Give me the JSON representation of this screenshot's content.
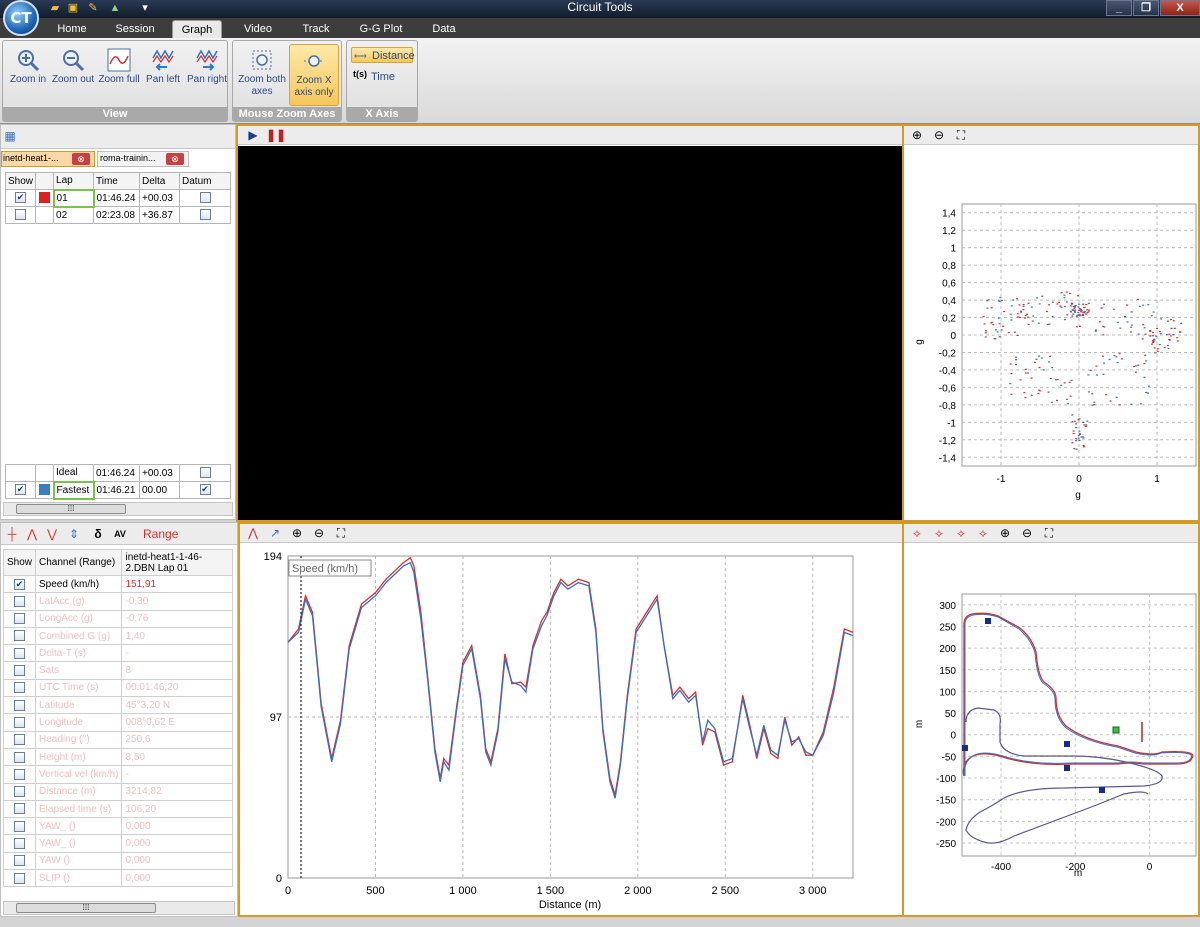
{
  "window": {
    "title": "Circuit Tools",
    "logo": "CT",
    "minimize": "_",
    "restore": "❐",
    "close": "X"
  },
  "menu": [
    "Home",
    "Session",
    "Graph",
    "Video",
    "Track",
    "G-G Plot",
    "Data"
  ],
  "ribbon": {
    "view_group": "View",
    "zoom_in": "Zoom in",
    "zoom_out": "Zoom out",
    "zoom_full": "Zoom full",
    "pan_left": "Pan left",
    "pan_right": "Pan right",
    "mouse_group": "Mouse Zoom Axes",
    "zoom_both": "Zoom both axes",
    "zoom_x": "Zoom X axis only",
    "xaxis_group": "X Axis",
    "distance": "Distance",
    "time_icon": "t(s)",
    "time": "Time"
  },
  "laps": {
    "session_tabs": [
      "inetd-heat1-...",
      "roma-trainin..."
    ],
    "headers": {
      "show": "Show",
      "lap": "Lap",
      "time": "Time",
      "delta": "Delta",
      "datum": "Datum"
    },
    "rows": [
      {
        "lap": "01",
        "time": "01:46.24",
        "delta": "+00.03",
        "checked": true,
        "color": "#e02020"
      },
      {
        "lap": "02",
        "time": "02:23.08",
        "delta": "+36.87",
        "checked": false,
        "color": ""
      }
    ],
    "ideal": {
      "lap": "Ideal",
      "time": "01:46.24",
      "delta": "+00.03"
    },
    "fastest": {
      "lap": "Fastest",
      "time": "01:46.21",
      "delta": "00.00",
      "color": "#3a7fc2"
    }
  },
  "channels": {
    "range_label": "Range",
    "headers": {
      "show": "Show",
      "channel": "Channel (Range)",
      "session": "inetd-heat1-1-46-2.DBN Lap 01"
    },
    "rows": [
      {
        "name": "Speed (km/h)",
        "value": "151,91",
        "checked": true
      },
      {
        "name": "LatAcc (g)",
        "value": "-0,30",
        "checked": false
      },
      {
        "name": "LongAcc (g)",
        "value": "-0,76",
        "checked": false
      },
      {
        "name": "Combined G (g)",
        "value": "1,40",
        "checked": false
      },
      {
        "name": "Delta-T (s)",
        "value": "-",
        "checked": false
      },
      {
        "name": "Sats",
        "value": "8",
        "checked": false
      },
      {
        "name": "UTC Time (s)",
        "value": "00:01:46,20",
        "checked": false
      },
      {
        "name": "Latitude",
        "value": "45°3,20 N",
        "checked": false
      },
      {
        "name": "Longitude",
        "value": "008°0,62 E",
        "checked": false
      },
      {
        "name": "Heading (°)",
        "value": "250,6",
        "checked": false
      },
      {
        "name": "Height (m)",
        "value": "8,50",
        "checked": false
      },
      {
        "name": "Vertical vel (km/h)",
        "value": "-",
        "checked": false
      },
      {
        "name": "Distance (m)",
        "value": "3214,82",
        "checked": false
      },
      {
        "name": "Elapsed time (s)",
        "value": "106,20",
        "checked": false
      },
      {
        "name": "YAW_ ()",
        "value": "0,000",
        "checked": false
      },
      {
        "name": "YAW_ ()",
        "value": "0,000",
        "checked": false
      },
      {
        "name": "YAW ()",
        "value": "0,000",
        "checked": false
      },
      {
        "name": "SLIP ()",
        "value": "0,000",
        "checked": false
      }
    ]
  },
  "gg_plot": {
    "xlabel": "g",
    "ylabel": "g",
    "xticks": [
      "-1",
      "0",
      "1"
    ],
    "yticks": [
      "1,4",
      "1,2",
      "1",
      "0,8",
      "0,6",
      "0,4",
      "0,2",
      "0",
      "-0,2",
      "-0,4",
      "-0,6",
      "-0,8",
      "-1",
      "-1,2",
      "-1,4"
    ],
    "colors": {
      "lap01": "#d23030",
      "fastest": "#3a6fc0"
    }
  },
  "speed_chart": {
    "label": "Speed (km/h)",
    "xlabel": "Distance (m)",
    "yticks": [
      "194",
      "97",
      "0"
    ],
    "xticks": [
      "0",
      "500",
      "1 000",
      "1 500",
      "2 000",
      "2 500",
      "3 000"
    ],
    "colors": {
      "lap01": "#d23030",
      "fastest": "#3a6fc0"
    }
  },
  "track_map": {
    "xlabel": "m",
    "ylabel": "m",
    "xticks": [
      "-400",
      "-200",
      "0"
    ],
    "yticks": [
      "300",
      "250",
      "200",
      "150",
      "100",
      "50",
      "0",
      "-50",
      "-100",
      "-150",
      "-200",
      "-250"
    ]
  },
  "chart_data": [
    {
      "type": "line",
      "title": "",
      "xlabel": "Distance (m)",
      "ylabel": "Speed (km/h)",
      "xlim": [
        0,
        3230
      ],
      "ylim": [
        0,
        194
      ],
      "series": [
        {
          "x": [
            0,
            60,
            100,
            140,
            190,
            250,
            300,
            350,
            420,
            500,
            560,
            620,
            660,
            700,
            720,
            760,
            800,
            840,
            870,
            890,
            920,
            960,
            1000,
            1050,
            1100,
            1130,
            1160,
            1200,
            1240,
            1280,
            1330,
            1360,
            1400,
            1450,
            1480,
            1520,
            1560,
            1600,
            1660,
            1720,
            1760,
            1800,
            1840,
            1870,
            1900,
            1940,
            1990,
            2050,
            2110,
            2150,
            2200,
            2240,
            2290,
            2330,
            2370,
            2400,
            2440,
            2490,
            2540,
            2600,
            2640,
            2680,
            2720,
            2760,
            2800,
            2840,
            2880,
            2920,
            2960,
            3000,
            3060,
            3120,
            3180,
            3230
          ],
          "values": [
            142,
            150,
            170,
            160,
            105,
            72,
            95,
            140,
            165,
            172,
            180,
            186,
            190,
            193,
            188,
            160,
            120,
            78,
            60,
            72,
            68,
            100,
            130,
            140,
            110,
            78,
            70,
            90,
            135,
            117,
            118,
            115,
            140,
            155,
            160,
            172,
            180,
            176,
            180,
            178,
            150,
            90,
            60,
            50,
            70,
            110,
            150,
            160,
            170,
            140,
            110,
            115,
            108,
            112,
            80,
            90,
            88,
            68,
            70,
            110,
            92,
            72,
            90,
            75,
            72,
            97,
            80,
            85,
            74,
            74,
            88,
            115,
            150,
            148
          ]
        },
        {
          "x": [
            0,
            60,
            100,
            140,
            190,
            250,
            300,
            350,
            420,
            500,
            560,
            620,
            660,
            700,
            720,
            760,
            800,
            840,
            870,
            890,
            920,
            960,
            1000,
            1050,
            1100,
            1130,
            1160,
            1200,
            1240,
            1280,
            1330,
            1360,
            1400,
            1450,
            1480,
            1520,
            1560,
            1600,
            1660,
            1720,
            1760,
            1800,
            1840,
            1870,
            1900,
            1940,
            1990,
            2050,
            2110,
            2150,
            2200,
            2240,
            2290,
            2330,
            2370,
            2400,
            2440,
            2490,
            2540,
            2600,
            2640,
            2680,
            2720,
            2760,
            2800,
            2840,
            2880,
            2920,
            2960,
            3000,
            3060,
            3120,
            3180,
            3230
          ],
          "values": [
            142,
            148,
            168,
            158,
            103,
            70,
            93,
            138,
            163,
            170,
            178,
            184,
            188,
            190,
            184,
            156,
            118,
            76,
            58,
            70,
            65,
            98,
            128,
            138,
            108,
            76,
            68,
            88,
            132,
            118,
            116,
            112,
            138,
            152,
            158,
            170,
            178,
            174,
            178,
            176,
            148,
            88,
            58,
            48,
            68,
            108,
            148,
            158,
            168,
            140,
            108,
            113,
            106,
            110,
            82,
            95,
            90,
            70,
            72,
            108,
            90,
            74,
            92,
            77,
            74,
            95,
            82,
            84,
            76,
            74,
            86,
            112,
            148,
            146
          ]
        }
      ]
    }
  ]
}
